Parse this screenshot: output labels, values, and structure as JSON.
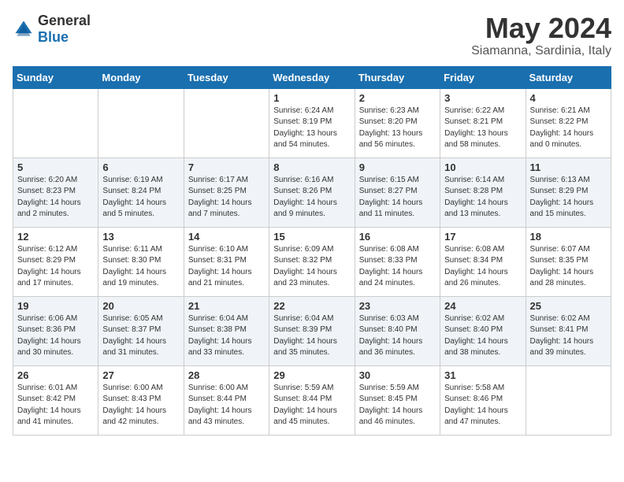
{
  "logo": {
    "general": "General",
    "blue": "Blue"
  },
  "header": {
    "month": "May 2024",
    "location": "Siamanna, Sardinia, Italy"
  },
  "weekdays": [
    "Sunday",
    "Monday",
    "Tuesday",
    "Wednesday",
    "Thursday",
    "Friday",
    "Saturday"
  ],
  "weeks": [
    [
      {
        "day": "",
        "sunrise": "",
        "sunset": "",
        "daylight": ""
      },
      {
        "day": "",
        "sunrise": "",
        "sunset": "",
        "daylight": ""
      },
      {
        "day": "",
        "sunrise": "",
        "sunset": "",
        "daylight": ""
      },
      {
        "day": "1",
        "sunrise": "Sunrise: 6:24 AM",
        "sunset": "Sunset: 8:19 PM",
        "daylight": "Daylight: 13 hours and 54 minutes."
      },
      {
        "day": "2",
        "sunrise": "Sunrise: 6:23 AM",
        "sunset": "Sunset: 8:20 PM",
        "daylight": "Daylight: 13 hours and 56 minutes."
      },
      {
        "day": "3",
        "sunrise": "Sunrise: 6:22 AM",
        "sunset": "Sunset: 8:21 PM",
        "daylight": "Daylight: 13 hours and 58 minutes."
      },
      {
        "day": "4",
        "sunrise": "Sunrise: 6:21 AM",
        "sunset": "Sunset: 8:22 PM",
        "daylight": "Daylight: 14 hours and 0 minutes."
      }
    ],
    [
      {
        "day": "5",
        "sunrise": "Sunrise: 6:20 AM",
        "sunset": "Sunset: 8:23 PM",
        "daylight": "Daylight: 14 hours and 2 minutes."
      },
      {
        "day": "6",
        "sunrise": "Sunrise: 6:19 AM",
        "sunset": "Sunset: 8:24 PM",
        "daylight": "Daylight: 14 hours and 5 minutes."
      },
      {
        "day": "7",
        "sunrise": "Sunrise: 6:17 AM",
        "sunset": "Sunset: 8:25 PM",
        "daylight": "Daylight: 14 hours and 7 minutes."
      },
      {
        "day": "8",
        "sunrise": "Sunrise: 6:16 AM",
        "sunset": "Sunset: 8:26 PM",
        "daylight": "Daylight: 14 hours and 9 minutes."
      },
      {
        "day": "9",
        "sunrise": "Sunrise: 6:15 AM",
        "sunset": "Sunset: 8:27 PM",
        "daylight": "Daylight: 14 hours and 11 minutes."
      },
      {
        "day": "10",
        "sunrise": "Sunrise: 6:14 AM",
        "sunset": "Sunset: 8:28 PM",
        "daylight": "Daylight: 14 hours and 13 minutes."
      },
      {
        "day": "11",
        "sunrise": "Sunrise: 6:13 AM",
        "sunset": "Sunset: 8:29 PM",
        "daylight": "Daylight: 14 hours and 15 minutes."
      }
    ],
    [
      {
        "day": "12",
        "sunrise": "Sunrise: 6:12 AM",
        "sunset": "Sunset: 8:29 PM",
        "daylight": "Daylight: 14 hours and 17 minutes."
      },
      {
        "day": "13",
        "sunrise": "Sunrise: 6:11 AM",
        "sunset": "Sunset: 8:30 PM",
        "daylight": "Daylight: 14 hours and 19 minutes."
      },
      {
        "day": "14",
        "sunrise": "Sunrise: 6:10 AM",
        "sunset": "Sunset: 8:31 PM",
        "daylight": "Daylight: 14 hours and 21 minutes."
      },
      {
        "day": "15",
        "sunrise": "Sunrise: 6:09 AM",
        "sunset": "Sunset: 8:32 PM",
        "daylight": "Daylight: 14 hours and 23 minutes."
      },
      {
        "day": "16",
        "sunrise": "Sunrise: 6:08 AM",
        "sunset": "Sunset: 8:33 PM",
        "daylight": "Daylight: 14 hours and 24 minutes."
      },
      {
        "day": "17",
        "sunrise": "Sunrise: 6:08 AM",
        "sunset": "Sunset: 8:34 PM",
        "daylight": "Daylight: 14 hours and 26 minutes."
      },
      {
        "day": "18",
        "sunrise": "Sunrise: 6:07 AM",
        "sunset": "Sunset: 8:35 PM",
        "daylight": "Daylight: 14 hours and 28 minutes."
      }
    ],
    [
      {
        "day": "19",
        "sunrise": "Sunrise: 6:06 AM",
        "sunset": "Sunset: 8:36 PM",
        "daylight": "Daylight: 14 hours and 30 minutes."
      },
      {
        "day": "20",
        "sunrise": "Sunrise: 6:05 AM",
        "sunset": "Sunset: 8:37 PM",
        "daylight": "Daylight: 14 hours and 31 minutes."
      },
      {
        "day": "21",
        "sunrise": "Sunrise: 6:04 AM",
        "sunset": "Sunset: 8:38 PM",
        "daylight": "Daylight: 14 hours and 33 minutes."
      },
      {
        "day": "22",
        "sunrise": "Sunrise: 6:04 AM",
        "sunset": "Sunset: 8:39 PM",
        "daylight": "Daylight: 14 hours and 35 minutes."
      },
      {
        "day": "23",
        "sunrise": "Sunrise: 6:03 AM",
        "sunset": "Sunset: 8:40 PM",
        "daylight": "Daylight: 14 hours and 36 minutes."
      },
      {
        "day": "24",
        "sunrise": "Sunrise: 6:02 AM",
        "sunset": "Sunset: 8:40 PM",
        "daylight": "Daylight: 14 hours and 38 minutes."
      },
      {
        "day": "25",
        "sunrise": "Sunrise: 6:02 AM",
        "sunset": "Sunset: 8:41 PM",
        "daylight": "Daylight: 14 hours and 39 minutes."
      }
    ],
    [
      {
        "day": "26",
        "sunrise": "Sunrise: 6:01 AM",
        "sunset": "Sunset: 8:42 PM",
        "daylight": "Daylight: 14 hours and 41 minutes."
      },
      {
        "day": "27",
        "sunrise": "Sunrise: 6:00 AM",
        "sunset": "Sunset: 8:43 PM",
        "daylight": "Daylight: 14 hours and 42 minutes."
      },
      {
        "day": "28",
        "sunrise": "Sunrise: 6:00 AM",
        "sunset": "Sunset: 8:44 PM",
        "daylight": "Daylight: 14 hours and 43 minutes."
      },
      {
        "day": "29",
        "sunrise": "Sunrise: 5:59 AM",
        "sunset": "Sunset: 8:44 PM",
        "daylight": "Daylight: 14 hours and 45 minutes."
      },
      {
        "day": "30",
        "sunrise": "Sunrise: 5:59 AM",
        "sunset": "Sunset: 8:45 PM",
        "daylight": "Daylight: 14 hours and 46 minutes."
      },
      {
        "day": "31",
        "sunrise": "Sunrise: 5:58 AM",
        "sunset": "Sunset: 8:46 PM",
        "daylight": "Daylight: 14 hours and 47 minutes."
      },
      {
        "day": "",
        "sunrise": "",
        "sunset": "",
        "daylight": ""
      }
    ]
  ]
}
